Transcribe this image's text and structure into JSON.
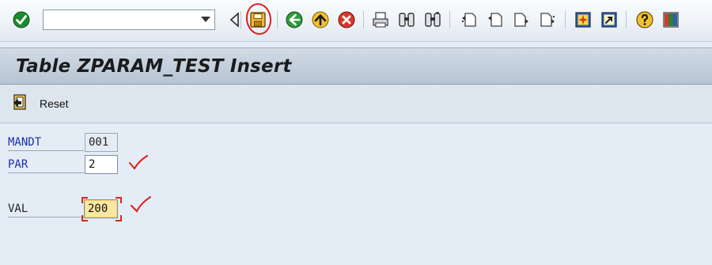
{
  "toolbar": {
    "command_value": "",
    "buttons": [
      {
        "name": "enter-icon",
        "title": "Enter"
      },
      {
        "name": "save-icon",
        "title": "Save"
      },
      {
        "name": "back-icon",
        "title": "Back"
      },
      {
        "name": "exit-icon",
        "title": "Exit"
      },
      {
        "name": "cancel-icon",
        "title": "Cancel"
      }
    ]
  },
  "title": "Table ZPARAM_TEST Insert",
  "app_toolbar": {
    "reset_label": "Reset"
  },
  "form": {
    "mandt": {
      "label": "MANDT",
      "value": "001"
    },
    "par": {
      "label": "PAR",
      "value": "2"
    },
    "val": {
      "label": "VAL",
      "value": "200"
    }
  },
  "colors": {
    "annotation": "#e21c1c",
    "label_key": "#1a2fa6",
    "focus_field": "#fbe8a0"
  }
}
